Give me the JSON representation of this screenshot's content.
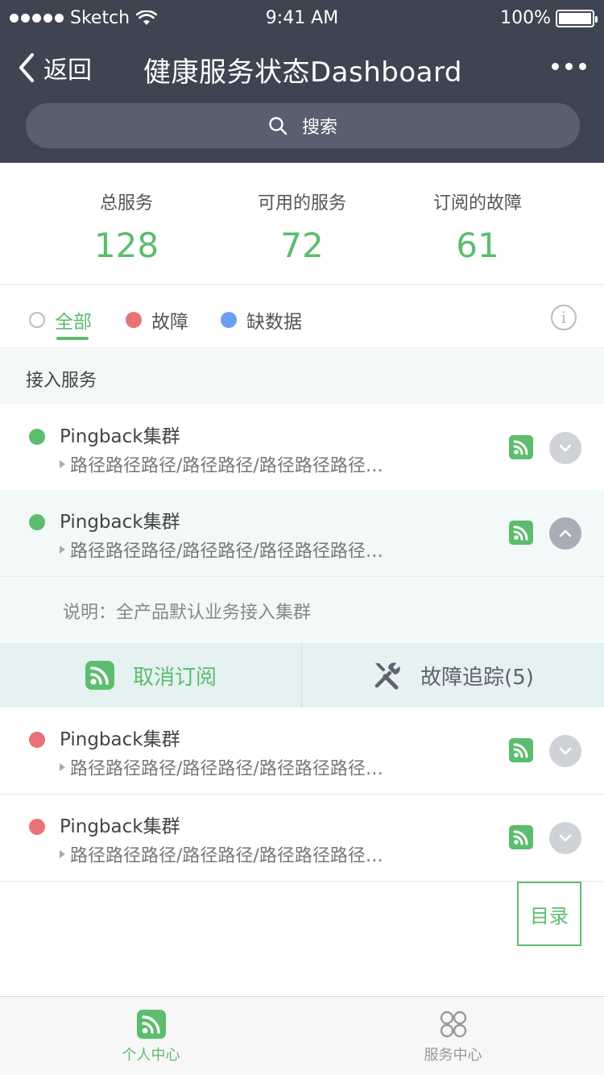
{
  "status_bar": {
    "carrier": "Sketch",
    "time": "9:41 AM",
    "battery": "100%"
  },
  "nav": {
    "back_label": "返回",
    "title": "健康服务状态Dashboard"
  },
  "search": {
    "placeholder": "搜索"
  },
  "stats": [
    {
      "label": "总服务",
      "value": "128"
    },
    {
      "label": "可用的服务",
      "value": "72"
    },
    {
      "label": "订阅的故障",
      "value": "61"
    }
  ],
  "filters": [
    {
      "label": "全部",
      "selected": true
    },
    {
      "label": "故障"
    },
    {
      "label": "缺数据"
    }
  ],
  "section": {
    "title": "接入服务"
  },
  "services": [
    {
      "name": "Pingback集群",
      "path": "路径路径路径/路径路径/路径路径路径…",
      "status": "green",
      "expanded": false
    },
    {
      "name": "Pingback集群",
      "path": "路径路径路径/路径路径/路径路径路径…",
      "status": "green",
      "expanded": true
    },
    {
      "name": "Pingback集群",
      "path": "路径路径路径/路径路径/路径路径路径…",
      "status": "red",
      "expanded": false
    },
    {
      "name": "Pingback集群",
      "path": "路径路径路径/路径路径/路径路径路径…",
      "status": "red",
      "expanded": false
    }
  ],
  "expanded_detail": {
    "description": "说明：全产品默认业务接入集群",
    "unsubscribe_label": "取消订阅",
    "trace_label": "故障追踪(5)"
  },
  "toc_button": {
    "label": "目录"
  },
  "tabbar": [
    {
      "label": "个人中心",
      "icon": "rss-icon",
      "active": true
    },
    {
      "label": "服务中心",
      "icon": "grid-icon",
      "active": false
    }
  ],
  "colors": {
    "header": "#3f4452",
    "accent_green": "#5bbd6d",
    "fault_red": "#e8717a",
    "nodata_blue": "#6d9ef2"
  }
}
